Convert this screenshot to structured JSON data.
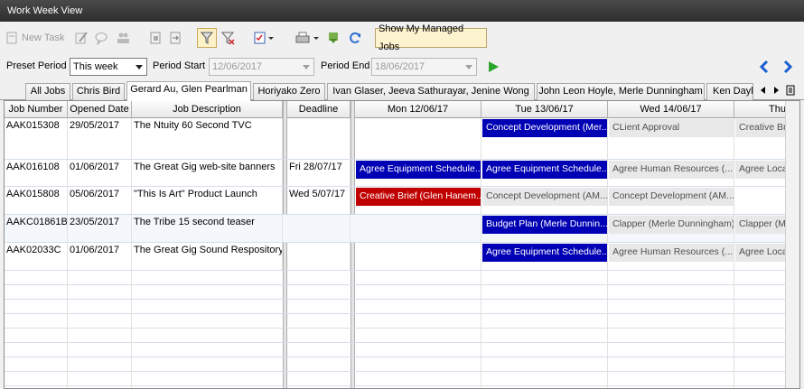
{
  "window": {
    "title": "Work Week View"
  },
  "toolbar": {
    "new_task_label": "New Task",
    "show_managed_label": "Show My Managed Jobs"
  },
  "filters": {
    "preset_label": "Preset Period",
    "preset_value": "This week",
    "start_label": "Period Start",
    "start_value": "12/06/2017",
    "end_label": "Period End",
    "end_value": "18/06/2017"
  },
  "tabs": [
    {
      "label": "All Jobs"
    },
    {
      "label": "Chris Bird"
    },
    {
      "label": "Gerard Au, Glen Pearlman"
    },
    {
      "label": "Horiyako Zero"
    },
    {
      "label": "Ivan Glaser, Jeeva Sathurayar, Jenine Wong"
    },
    {
      "label": "John Leon Hoyle, Merle Dunningham"
    },
    {
      "label": "Ken Dayl"
    }
  ],
  "columns": {
    "job_number": "Job Number",
    "opened_date": "Opened Date",
    "description": "Job Description",
    "deadline": "Deadline",
    "days": [
      "Mon 12/06/17",
      "Tue 13/06/17",
      "Wed 14/06/17",
      "Thu"
    ]
  },
  "jobs": [
    {
      "number": "AAK015308",
      "opened": "29/05/2017",
      "description": "The Ntuity 60 Second TVC",
      "deadline": ""
    },
    {
      "number": "AAK016108",
      "opened": "01/06/2017",
      "description": "The Great Gig web-site banners",
      "deadline": "Fri 28/07/17"
    },
    {
      "number": "AAK015808",
      "opened": "05/06/2017",
      "description": "\"This Is Art\" Product Launch",
      "deadline": "Wed 5/07/17"
    },
    {
      "number": "AAKC01861B",
      "opened": "23/05/2017",
      "description": "The Tribe 15 second teaser",
      "deadline": ""
    },
    {
      "number": "AAK02033C",
      "opened": "01/06/2017",
      "description": "The Great Gig Sound Respository",
      "deadline": ""
    }
  ],
  "tasks": {
    "r0_tue": "Concept Development (Mer...",
    "r0_wed": "CLient Approval",
    "r0_thu": "Creative Bri",
    "r1_mon": "Agree Equipment Schedule...",
    "r1_tue": "Agree Equipment Schedule...",
    "r1_wed": "Agree Human Resources (...",
    "r1_thu": "Agree Locat",
    "r2_mon": "Creative Brief (Glen Hanem...",
    "r2_tue": "Concept Development (AM...",
    "r2_wed": "Concept Development (AM...",
    "r3_tue": "Budget Plan (Merle Dunnin...",
    "r3_wed": "Clapper (Merle Dunningham)",
    "r3_thu": "Clapper (Me",
    "r4_tue": "Agree Equipment Schedule...",
    "r4_wed": "Agree Human Resources (...",
    "r4_thu": "Agree Locat"
  },
  "colors": {
    "task_blue": "#0000b4",
    "task_red": "#c00000",
    "task_grey": "#e8e8e8",
    "nav_blue": "#1a5fd0",
    "play_green": "#2aa52a"
  },
  "icons": [
    "new-task-icon",
    "edit-icon",
    "comment-icon",
    "people-icon",
    "export-icon",
    "import-icon",
    "filter-icon",
    "clear-filter-icon",
    "checklist-icon",
    "print-icon",
    "download-icon",
    "refresh-icon",
    "play-icon",
    "prev-icon",
    "next-icon"
  ]
}
